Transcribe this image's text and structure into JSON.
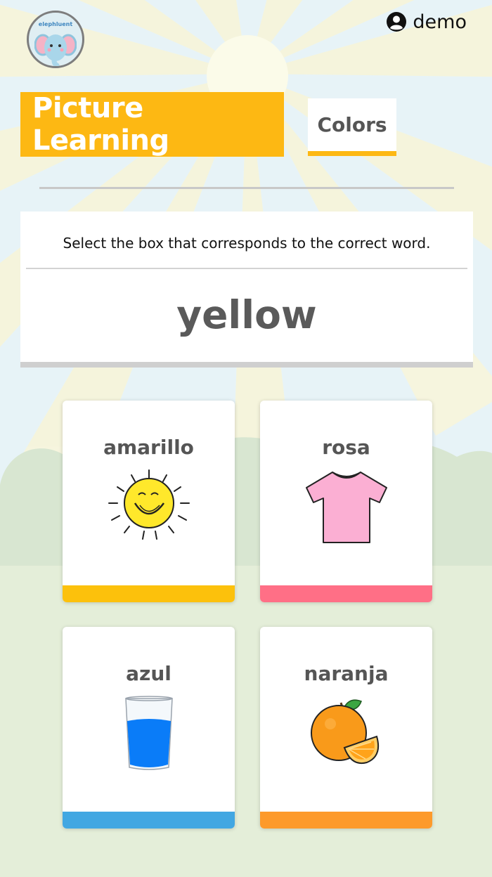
{
  "app": {
    "logo_text": "elephluent"
  },
  "header": {
    "username": "demo",
    "user_icon": "user-circle-icon"
  },
  "lesson": {
    "title": "Picture Learning",
    "topic": "Colors"
  },
  "question": {
    "instruction": "Select the box that corresponds to the correct word.",
    "word": "yellow"
  },
  "options": [
    {
      "label": "amarillo",
      "image": "sun-icon",
      "bar_color": "#fcc10c"
    },
    {
      "label": "rosa",
      "image": "pink-shirt-icon",
      "bar_color": "#ff6f86"
    },
    {
      "label": "azul",
      "image": "water-glass-icon",
      "bar_color": "#42a7e2"
    },
    {
      "label": "naranja",
      "image": "orange-fruit-icon",
      "bar_color": "#fd9a2b"
    }
  ],
  "colors": {
    "accent": "#fdb813",
    "sky": "#e7f3f7",
    "grass": "#e4eed9"
  }
}
